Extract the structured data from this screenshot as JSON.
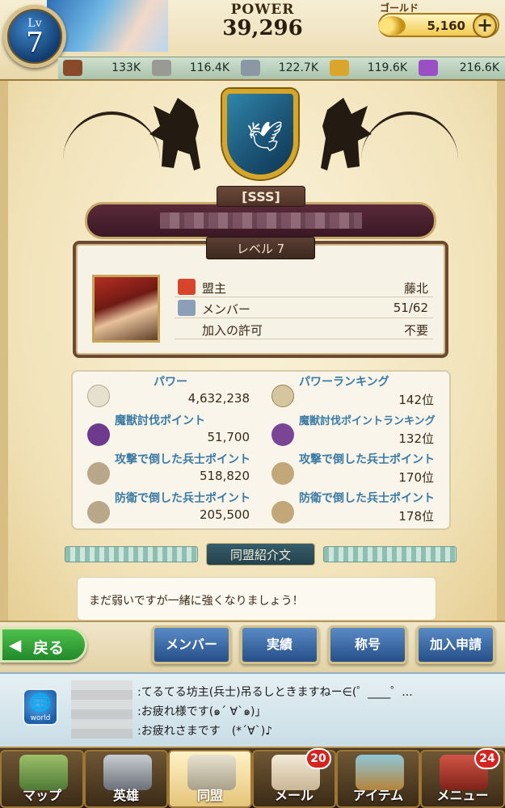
{
  "player": {
    "level_label": "Lv",
    "level": "7"
  },
  "power": {
    "label": "POWER",
    "value": "39,296"
  },
  "gold": {
    "label": "ゴールド",
    "value": "5,160",
    "plus": "+"
  },
  "resources": [
    {
      "icon": "wood-log-icon",
      "value": "133K",
      "color": "#8a4a2a"
    },
    {
      "icon": "stone-icon",
      "value": "116.4K",
      "color": "#9a9a94"
    },
    {
      "icon": "iron-ingot-icon",
      "value": "122.7K",
      "color": "#8c97a6"
    },
    {
      "icon": "wheat-icon",
      "value": "119.6K",
      "color": "#d9a52a"
    },
    {
      "icon": "crystal-icon",
      "value": "216.6K",
      "color": "#9a4fc4"
    }
  ],
  "alliance": {
    "tag": "[SSS]",
    "level": "レベル 7",
    "info": [
      {
        "icon": "leader-flag-icon",
        "label": "盟主",
        "value": "藤北"
      },
      {
        "icon": "members-icon",
        "label": "メンバー",
        "value": "51/62"
      },
      {
        "icon": "",
        "label": "加入の許可",
        "value": "不要"
      }
    ],
    "stats": [
      {
        "icon": "power-wings-icon",
        "label": "パワー",
        "value": "4,632,238"
      },
      {
        "icon": "power-ranking-icon",
        "label": "パワーランキング",
        "value": "142位"
      },
      {
        "icon": "beast-hunt-icon",
        "label": "魔獣討伐ポイント",
        "value": "51,700"
      },
      {
        "icon": "beast-hunt-ranking-icon",
        "label": "魔獣討伐ポイントランキング",
        "value": "132位"
      },
      {
        "icon": "attack-kill-icon",
        "label": "攻撃で倒した兵士ポイント",
        "value": "518,820"
      },
      {
        "icon": "attack-kill-ranking-icon",
        "label": "攻撃で倒した兵士ポイント",
        "value": "170位"
      },
      {
        "icon": "defense-kill-icon",
        "label": "防衛で倒した兵士ポイント",
        "value": "205,500"
      },
      {
        "icon": "defense-kill-ranking-icon",
        "label": "防衛で倒した兵士ポイント",
        "value": "178位"
      }
    ],
    "intro_title": "同盟紹介文",
    "intro_text": "まだ弱いですが一緒に強くなりましょう！"
  },
  "buttons": {
    "back": "戻る",
    "members": "メンバー",
    "achievements": "実績",
    "titles": "称号",
    "join": "加入申請"
  },
  "chat": {
    "world_label": "world",
    "lines": [
      ":てるてる坊主(兵士)吊るしときますねー∈(゜____゜...",
      ":お疲れ様です(๑´ ∀`๑)」",
      ":お疲れさまです　(*´∀`)♪"
    ]
  },
  "tabs": [
    {
      "label": "マップ",
      "badge": ""
    },
    {
      "label": "英雄",
      "badge": ""
    },
    {
      "label": "同盟",
      "badge": ""
    },
    {
      "label": "メール",
      "badge": "20"
    },
    {
      "label": "アイテム",
      "badge": ""
    },
    {
      "label": "メニュー",
      "badge": "24"
    }
  ]
}
